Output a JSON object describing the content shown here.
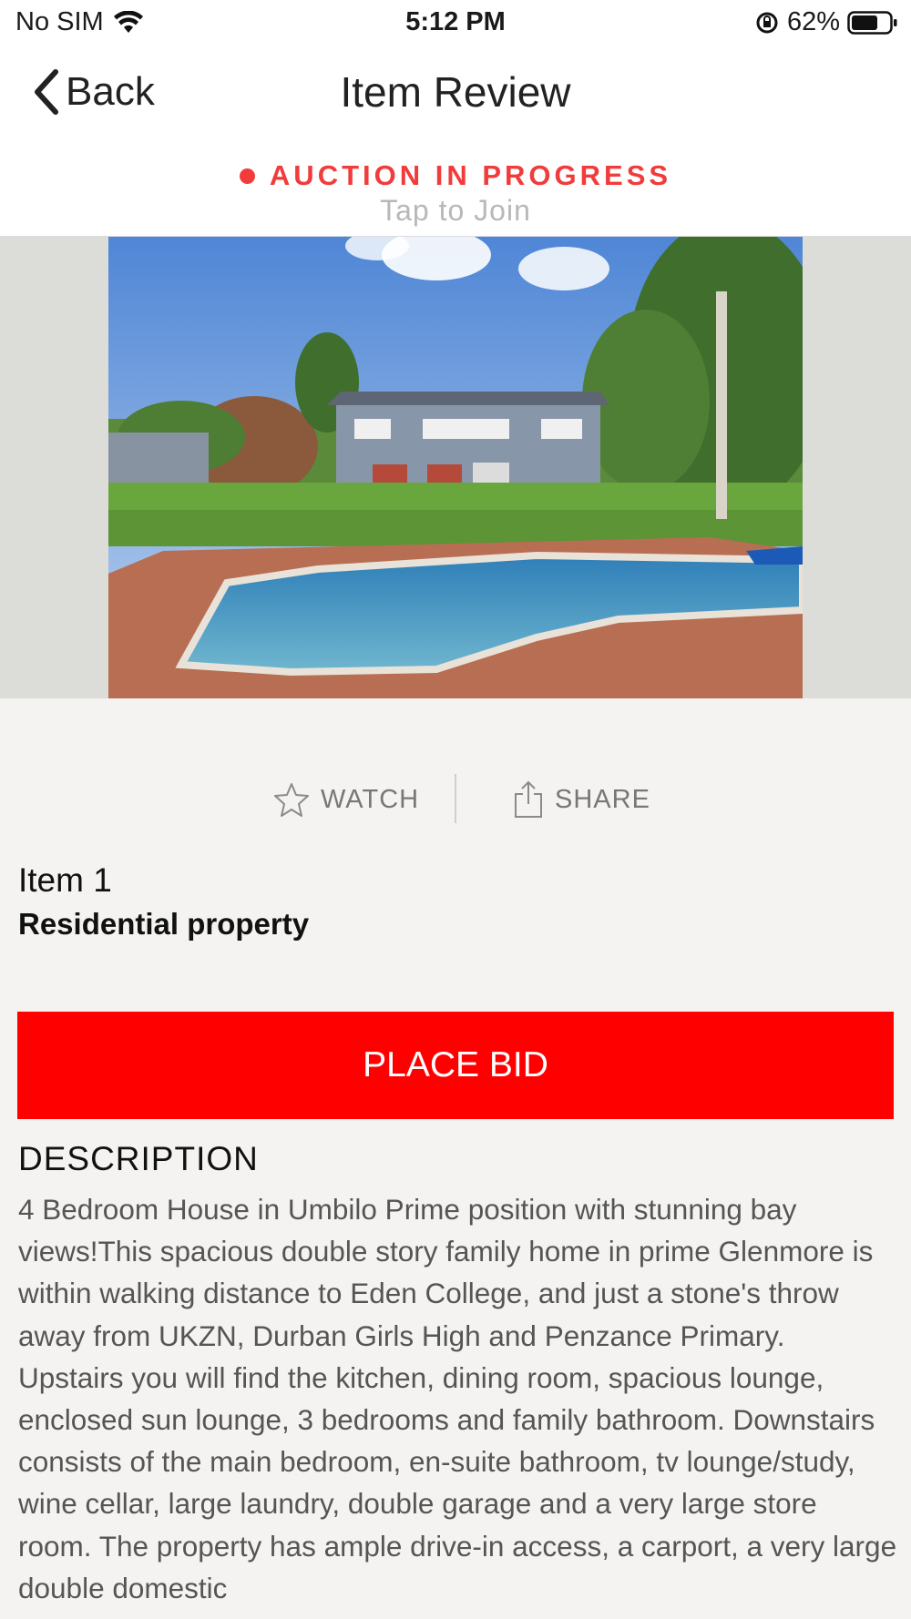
{
  "status_bar": {
    "carrier": "No SIM",
    "time": "5:12 PM",
    "battery": "62%",
    "icons": [
      "wifi-icon",
      "orientation-lock-icon",
      "battery-icon"
    ]
  },
  "nav": {
    "back_label": "Back",
    "title": "Item Review",
    "back_icon": "chevron-left-icon"
  },
  "auction": {
    "status": "AUCTION IN PROGRESS",
    "hint": "Tap to Join",
    "status_color": "#f23b3b"
  },
  "actions": {
    "watch_label": "WATCH",
    "share_label": "SHARE",
    "watch_icon": "star-icon",
    "share_icon": "share-icon"
  },
  "item": {
    "number": "Item 1",
    "type": "Residential property"
  },
  "bid": {
    "label": "PLACE BID",
    "color": "#ff0000"
  },
  "description": {
    "heading": "DESCRIPTION",
    "text": "4 Bedroom House in Umbilo Prime position with stunning bay views!This spacious double story family home in prime Glenmore is within walking distance to Eden College, and just a stone's throw away from UKZN, Durban Girls High and Penzance Primary. Upstairs you will find the kitchen, dining room, spacious lounge, enclosed sun lounge, 3 bedrooms and family bathroom. Downstairs consists of the main bedroom, en-suite bathroom, tv lounge/study, wine cellar, large laundry, double garage and a very large store room. The property has ample drive-in access, a carport, a very large double domestic"
  }
}
